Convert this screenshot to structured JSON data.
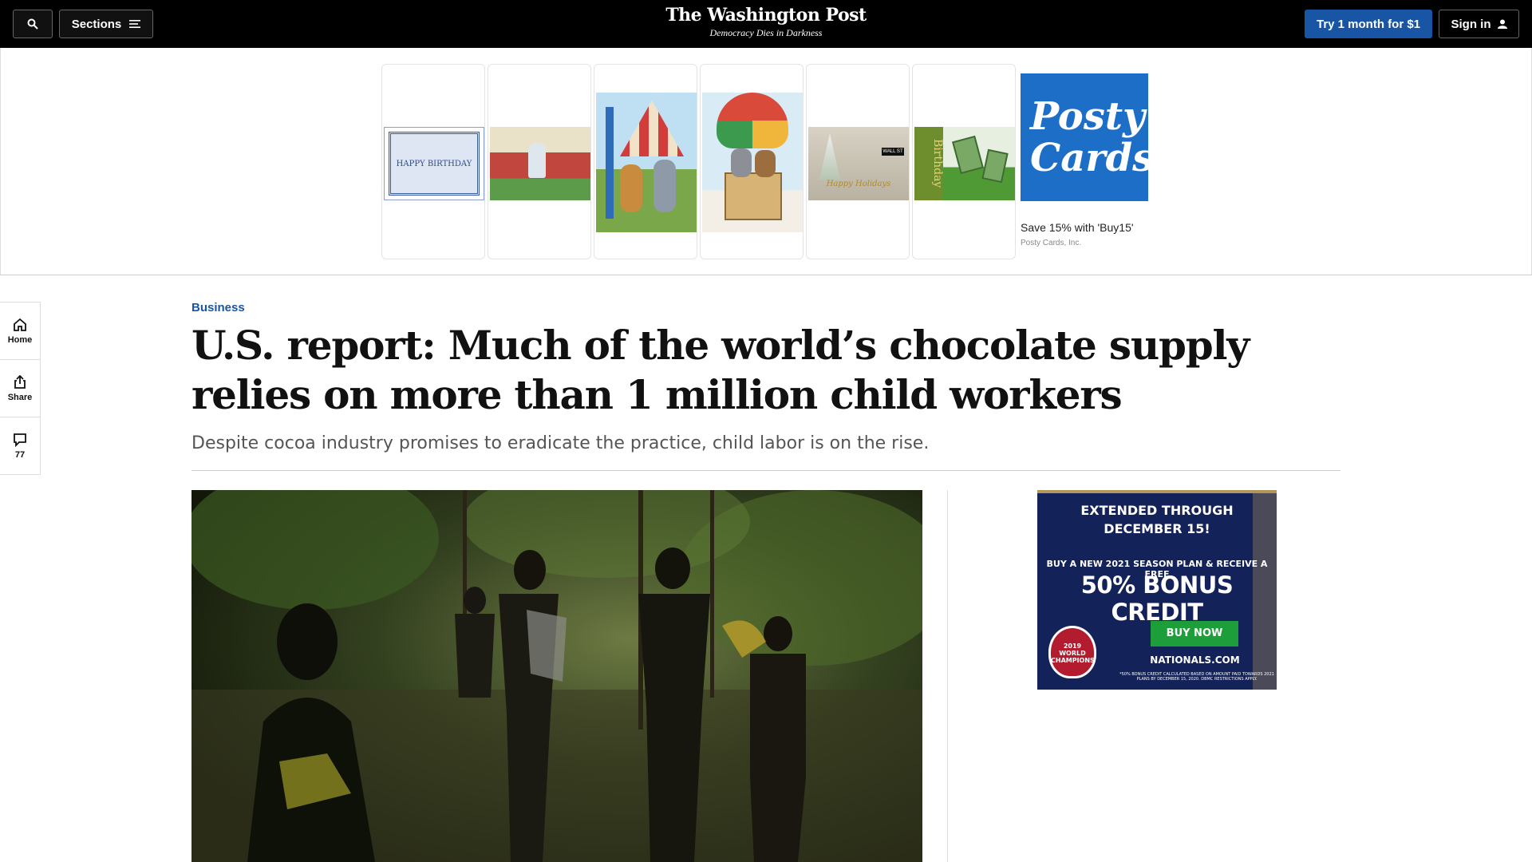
{
  "topbar": {
    "sections_label": "Sections",
    "logo": "The Washington Post",
    "tagline": "Democracy Dies in Darkness",
    "try_label": "Try 1 month for $1",
    "signin_label": "Sign in"
  },
  "ad_banner": {
    "card_texts": [
      "HAPPY BIRTHDAY",
      "Happy Holidays",
      "WALL ST",
      "Birthday"
    ],
    "posty_logo_line1": "Posty",
    "posty_logo_line2": "Cards",
    "posty_text": "Save 15% with 'Buy15'",
    "posty_sub": "Posty Cards, Inc."
  },
  "rail": {
    "home_label": "Home",
    "share_label": "Share",
    "comments_count": "77"
  },
  "article": {
    "kicker": "Business",
    "headline": "U.S. report: Much of the world’s chocolate supply relies on more than 1 million child workers",
    "dek": "Despite cocoa industry promises to eradicate the practice, child labor is on the rise."
  },
  "right_ad": {
    "line1": "EXTENDED THROUGH",
    "line2": "DECEMBER 15!",
    "buy_line": "BUY A NEW 2021 SEASON PLAN & RECEIVE A FREE",
    "big": "50% BONUS CREDIT",
    "button": "BUY NOW",
    "url": "NATIONALS.COM",
    "badge": "2019 WORLD CHAMPIONS",
    "fine": "*50% BONUS CREDIT CALCULATED BASED ON AMOUNT PAID TOWARDS 2021 PLANS BY DECEMBER 15, 2020. DBMC RESTRICTIONS APPLY."
  },
  "colors": {
    "accent_blue": "#1955a5",
    "topbar_bg": "#000000",
    "nats_navy": "#14225a",
    "nats_green": "#1e9e3a",
    "posty_blue": "#1d6ec7"
  },
  "icons": [
    "search-icon",
    "hamburger-icon",
    "user-icon",
    "home-icon",
    "share-icon",
    "comment-icon",
    "adchoices-icon",
    "close-icon"
  ]
}
